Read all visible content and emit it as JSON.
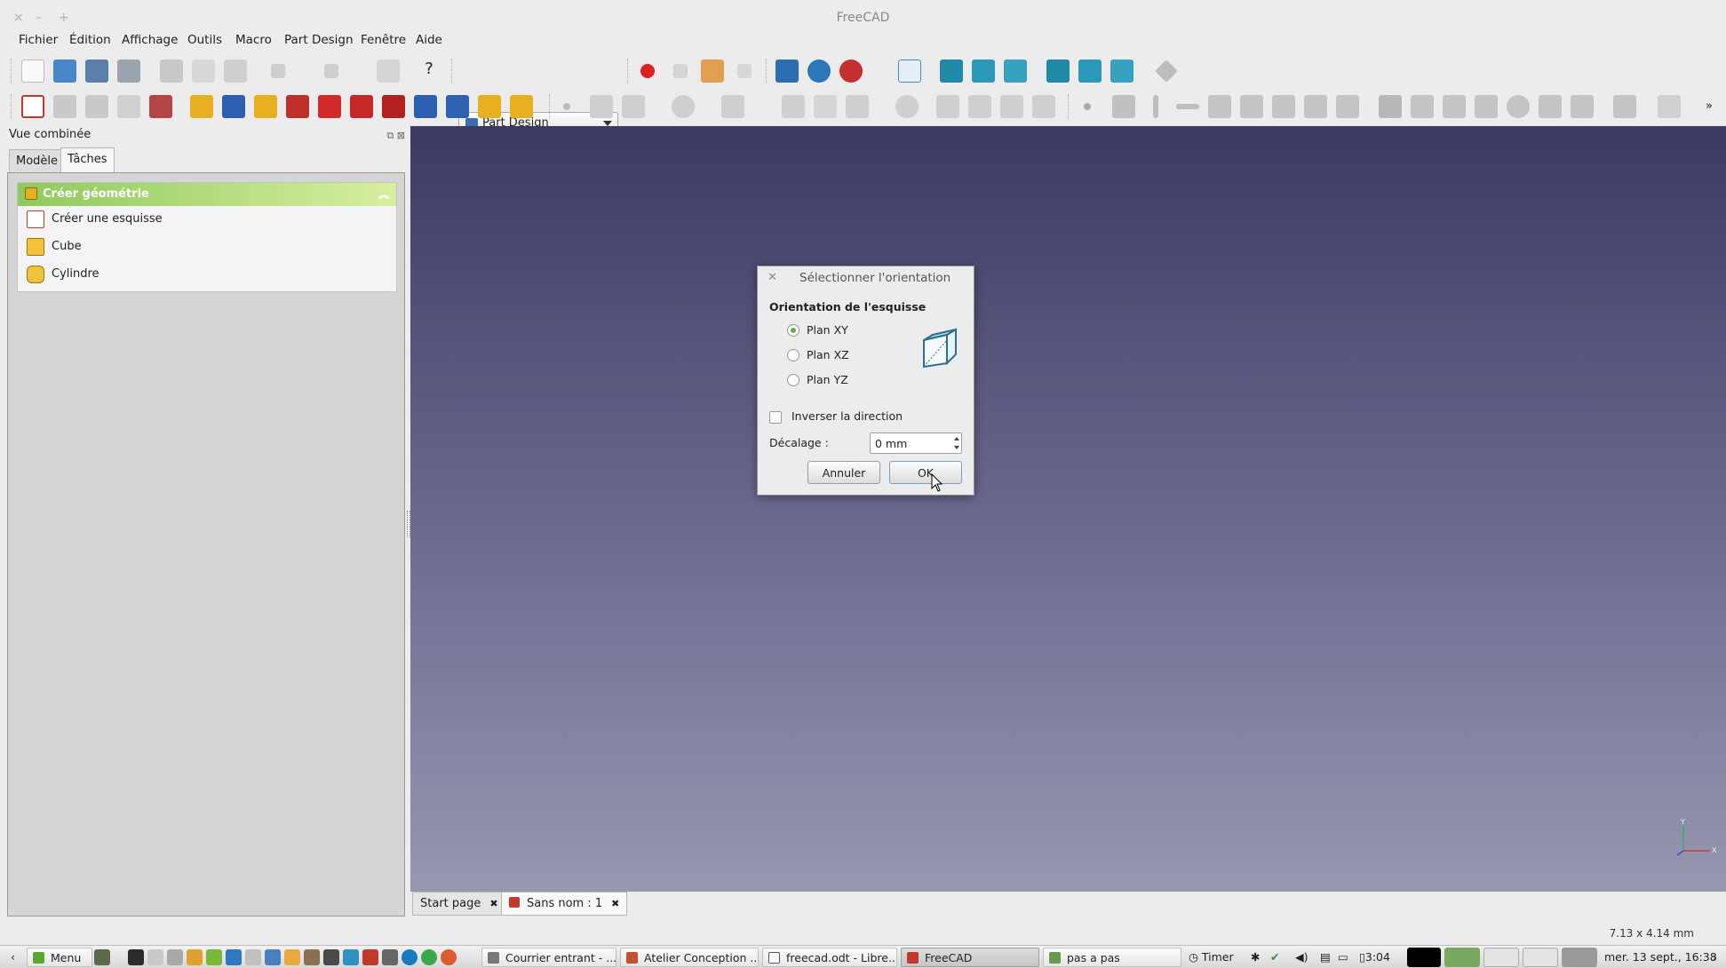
{
  "window": {
    "title": "FreeCAD",
    "controls": [
      "×",
      "–",
      "+"
    ]
  },
  "menubar": {
    "items": [
      {
        "label": "Fichier"
      },
      {
        "label": "Édition"
      },
      {
        "label": "Affichage"
      },
      {
        "label": "Outils"
      },
      {
        "label": "Macro"
      },
      {
        "label": "Part Design"
      },
      {
        "label": "Fenêtre"
      },
      {
        "label": "Aide"
      }
    ]
  },
  "toolbar": {
    "workbench": "Part Design"
  },
  "combo_view": {
    "title": "Vue combinée",
    "tabs": [
      "Modèle",
      "Tâches"
    ],
    "active_tab": "Tâches",
    "task_panel": {
      "header": "Créer géométrie",
      "items": [
        "Créer une esquisse",
        "Cube",
        "Cylindre"
      ]
    }
  },
  "dialog": {
    "title": "Sélectionner l'orientation",
    "group_label": "Orientation de l'esquisse",
    "options": [
      "Plan XY",
      "Plan XZ",
      "Plan YZ"
    ],
    "selected": "Plan XY",
    "reverse_label": "Inverser la direction",
    "reverse_checked": false,
    "offset_label": "Décalage :",
    "offset_value": "0 mm",
    "cancel_label": "Annuler",
    "ok_label": "OK"
  },
  "doc_tabs": [
    "Start page",
    "Sans nom : 1"
  ],
  "active_doc_tab": "Sans nom : 1",
  "statusbar": {
    "dimensions": "7.13 x 4.14 mm"
  },
  "axis": {
    "x": "X",
    "y": "Y"
  },
  "taskbar": {
    "menu_label": "Menu",
    "windows": [
      "Courrier entrant - ...",
      "Atelier Conception ...",
      "freecad.odt - Libre...",
      "FreeCAD",
      "pas a pas"
    ],
    "active_window": "FreeCAD",
    "timer_label": "Timer",
    "battery": "3:04",
    "clock": "mer. 13 sept., 16:38"
  }
}
